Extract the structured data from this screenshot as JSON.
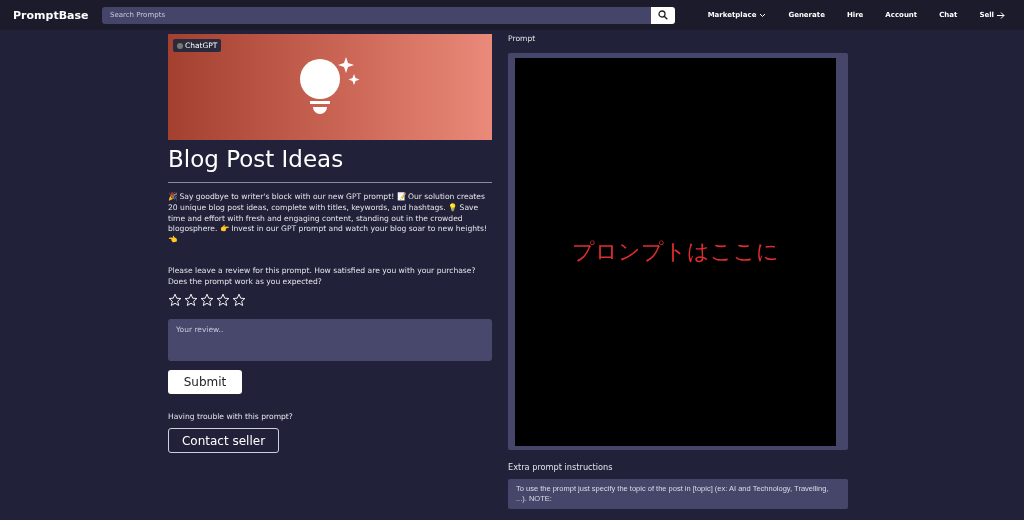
{
  "navbar": {
    "brand": "PromptBase",
    "search": {
      "placeholder": "Search Prompts"
    },
    "links": [
      {
        "label": "Marketplace",
        "kind": "dropdown"
      },
      {
        "label": "Generate",
        "kind": "link"
      },
      {
        "label": "Hire",
        "kind": "link"
      },
      {
        "label": "Account",
        "kind": "link"
      },
      {
        "label": "Chat",
        "kind": "link"
      },
      {
        "label": "Sell",
        "kind": "arrow"
      }
    ]
  },
  "product": {
    "badge": "ChatGPT",
    "title": "Blog Post Ideas",
    "description": "🎉 Say goodbye to writer's block with our new GPT prompt! 📝 Our solution creates 20 unique blog post ideas, complete with titles, keywords, and hashtags. 💡 Save time and effort with fresh and engaging content, standing out in the crowded blogosphere. 👉 Invest in our GPT prompt and watch your blog soar to new heights! 👈"
  },
  "review": {
    "question": "Please leave a review for this prompt. How satisfied are you with your purchase? Does the prompt work as you expected?",
    "stars": 0,
    "placeholder": "Your review..",
    "submit": "Submit"
  },
  "support": {
    "question": "Having trouble with this prompt?",
    "button": "Contact seller"
  },
  "prompt": {
    "label": "Prompt",
    "overlay": "プロンプトはここに"
  },
  "extra": {
    "label": "Extra prompt instructions",
    "text": "To use the prompt just specify the topic of the post in [topic] (ex: AI and Technology, Travelling, ...). NOTE:"
  }
}
